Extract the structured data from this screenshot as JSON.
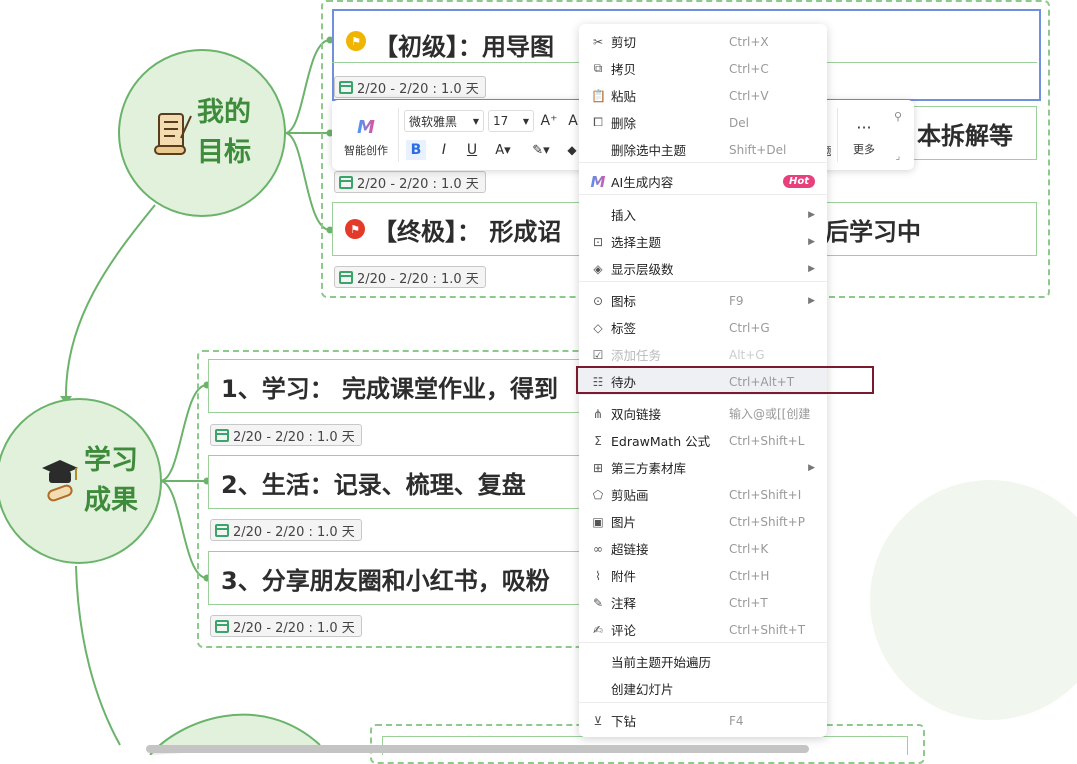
{
  "central_topics": {
    "goal": {
      "line1": "我的",
      "line2": "目标"
    },
    "results": {
      "line1": "学习",
      "line2": "成果"
    }
  },
  "goal_topics": [
    {
      "text": "【初级】：用导图",
      "date": "2/20 - 2/20 : 1.0 天",
      "flag_color": "#f0b500"
    },
    {
      "text": "本拆解等",
      "date": "2/20 - 2/20 : 1.0 天"
    },
    {
      "text": "【终极】： 形成诏",
      "text_right": "后学习中",
      "date": "2/20 - 2/20 : 1.0 天",
      "flag_color": "#e53a2a"
    }
  ],
  "result_topics": [
    {
      "text": "1、学习： 完成课堂作业，得到",
      "date": "2/20 - 2/20 : 1.0 天"
    },
    {
      "text": "2、生活：记录、梳理、复盘",
      "date": "2/20 - 2/20 : 1.0 天"
    },
    {
      "text": "3、分享朋友圈和小红书，吸粉",
      "date": "2/20 - 2/20 : 1.0 天"
    }
  ],
  "toolbar": {
    "ai_label": "智能创作",
    "font_family": "微软雅黑",
    "font_size": "17",
    "more_label": "更多",
    "partial_label": "题"
  },
  "context_menu": {
    "items": [
      {
        "label": "剪切",
        "shortcut": "Ctrl+X",
        "icon": "scissors-icon"
      },
      {
        "label": "拷贝",
        "shortcut": "Ctrl+C",
        "icon": "copy-icon"
      },
      {
        "label": "粘贴",
        "shortcut": "Ctrl+V",
        "icon": "paste-icon"
      },
      {
        "label": "删除",
        "shortcut": "Del",
        "icon": "delete-icon"
      },
      {
        "label": "删除选中主题",
        "shortcut": "Shift+Del",
        "icon": ""
      },
      {
        "label": "AI生成内容",
        "badge": "Hot",
        "icon": "ai-icon"
      },
      {
        "label": "插入",
        "submenu": true,
        "icon": ""
      },
      {
        "label": "选择主题",
        "submenu": true,
        "icon": "select-icon"
      },
      {
        "label": "显示层级数",
        "submenu": true,
        "icon": "layers-icon"
      },
      {
        "label": "图标",
        "shortcut": "F9",
        "submenu": true,
        "icon": "location-icon"
      },
      {
        "label": "标签",
        "shortcut": "Ctrl+G",
        "icon": "tag-icon"
      },
      {
        "label": "添加任务",
        "shortcut": "Alt+G",
        "disabled": true,
        "icon": "task-icon"
      },
      {
        "label": "待办",
        "shortcut": "Ctrl+Alt+T",
        "highlighted": true,
        "icon": "todo-icon"
      },
      {
        "label": "双向链接",
        "shortcut": "输入@或[[创建",
        "icon": "link-tree-icon"
      },
      {
        "label": "EdrawMath 公式",
        "shortcut": "Ctrl+Shift+L",
        "icon": "sigma-icon"
      },
      {
        "label": "第三方素材库",
        "submenu": true,
        "icon": "grid-icon"
      },
      {
        "label": "剪贴画",
        "shortcut": "Ctrl+Shift+I",
        "icon": "clipart-icon"
      },
      {
        "label": "图片",
        "shortcut": "Ctrl+Shift+P",
        "icon": "image-icon"
      },
      {
        "label": "超链接",
        "shortcut": "Ctrl+K",
        "icon": "hyperlink-icon"
      },
      {
        "label": "附件",
        "shortcut": "Ctrl+H",
        "icon": "paperclip-icon"
      },
      {
        "label": "注释",
        "shortcut": "Ctrl+T",
        "icon": "note-icon"
      },
      {
        "label": "评论",
        "shortcut": "Ctrl+Shift+T",
        "icon": "comment-icon"
      },
      {
        "label": "当前主题开始遍历",
        "icon": ""
      },
      {
        "label": "创建幻灯片",
        "icon": ""
      },
      {
        "label": "下钻",
        "shortcut": "F4",
        "icon": "drill-down-icon"
      }
    ]
  },
  "colors": {
    "branch_green": "#6bb36a",
    "selection_blue": "#6f8fdf",
    "highlight_border": "#7a1a2e",
    "hot_badge": "#e8407c"
  }
}
